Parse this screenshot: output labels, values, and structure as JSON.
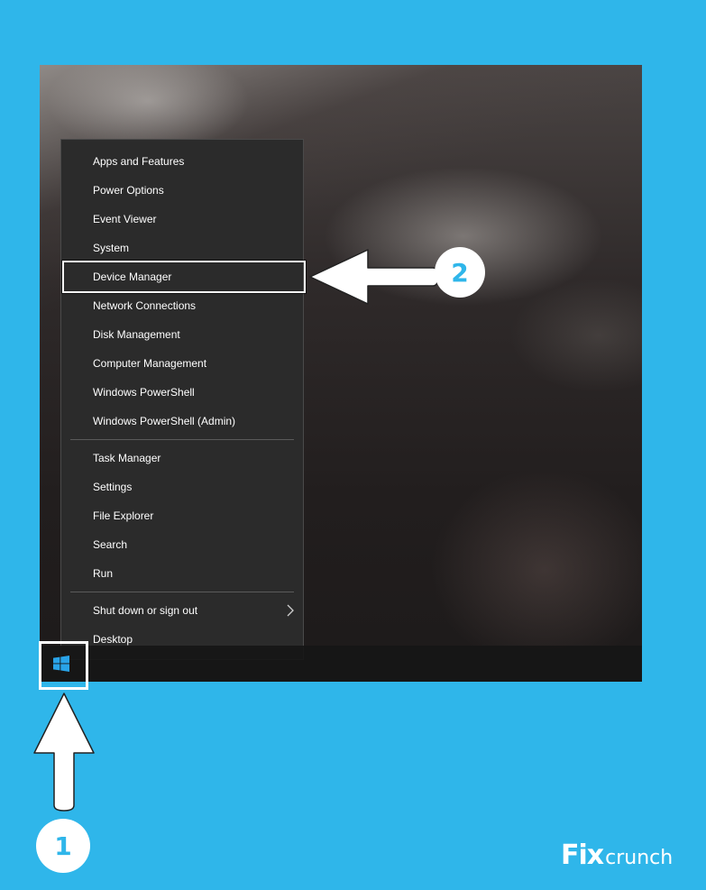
{
  "menu": {
    "items": [
      {
        "label": "Apps and Features"
      },
      {
        "label": "Power Options"
      },
      {
        "label": "Event Viewer"
      },
      {
        "label": "System"
      },
      {
        "label": "Device Manager"
      },
      {
        "label": "Network Connections"
      },
      {
        "label": "Disk Management"
      },
      {
        "label": "Computer Management"
      },
      {
        "label": "Windows PowerShell"
      },
      {
        "label": "Windows PowerShell (Admin)"
      },
      {
        "label": "Task Manager"
      },
      {
        "label": "Settings"
      },
      {
        "label": "File Explorer"
      },
      {
        "label": "Search"
      },
      {
        "label": "Run"
      },
      {
        "label": "Shut down or sign out",
        "submenu_icon": "chevron-right-icon"
      },
      {
        "label": "Desktop"
      }
    ]
  },
  "steps": {
    "one": "1",
    "two": "2"
  },
  "branding": {
    "logo_part1": "Fix",
    "logo_part2": "crunch"
  },
  "icons": {
    "start": "windows-logo-icon",
    "arrow_up": "arrow-up-icon",
    "arrow_left": "arrow-left-icon"
  },
  "colors": {
    "background": "#2fb6ea",
    "menu_bg": "#2b2b2b",
    "highlight": "#ffffff",
    "windows_logo": "#29a3e8"
  }
}
